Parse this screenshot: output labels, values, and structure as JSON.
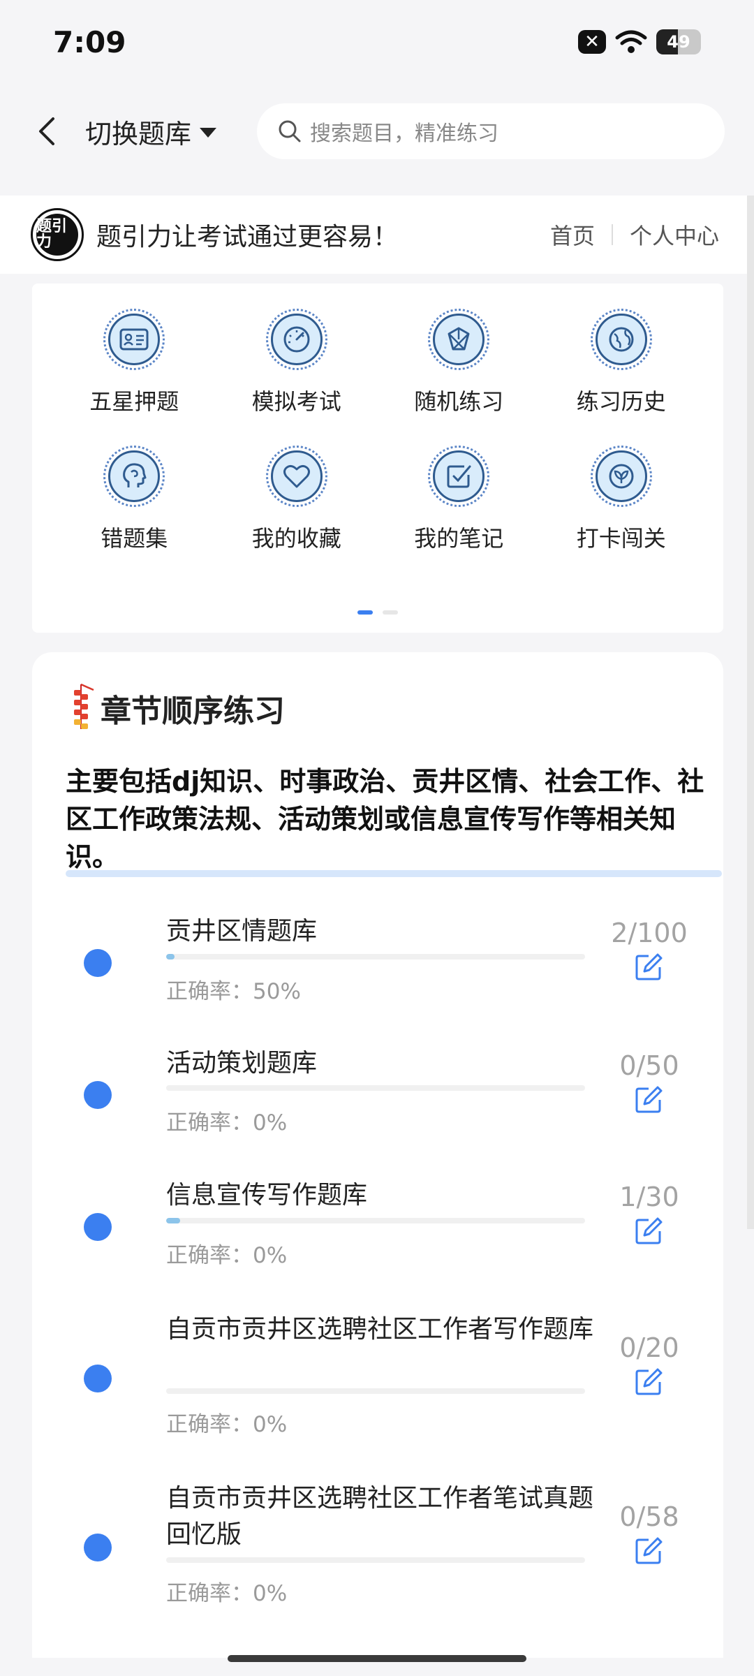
{
  "status_bar": {
    "time": "7:09",
    "battery": "49",
    "battery_level": 0.49
  },
  "header": {
    "switch_label": "切换题库",
    "search_placeholder": "搜索题目，精准练习"
  },
  "banner": {
    "slogan": "题引力让考试通过更容易！",
    "nav": [
      "首页",
      "个人中心"
    ],
    "logo_text": "题引力"
  },
  "grid": {
    "items": [
      {
        "label": "五星押题",
        "icon": "id-card-icon"
      },
      {
        "label": "模拟考试",
        "icon": "speedometer-icon"
      },
      {
        "label": "随机练习",
        "icon": "shuffle-icon"
      },
      {
        "label": "练习历史",
        "icon": "globe-icon"
      },
      {
        "label": "错题集",
        "icon": "head-icon"
      },
      {
        "label": "我的收藏",
        "icon": "heart-icon"
      },
      {
        "label": "我的笔记",
        "icon": "note-check-icon"
      },
      {
        "label": "打卡闯关",
        "icon": "leaf-badge-icon"
      }
    ],
    "page_count": 2,
    "active_page": 0
  },
  "chapter": {
    "title": "章节顺序练习",
    "description": "主要包括dj知识、时事政治、贡井区情、社会工作、社区工作政策法规、活动策划或信息宣传写作等相关知识。",
    "banks": [
      {
        "name": "贡井区情题库",
        "accuracy": "正确率：50%",
        "count": "2/100",
        "progress": 0.02
      },
      {
        "name": "活动策划题库",
        "accuracy": "正确率：0%",
        "count": "0/50",
        "progress": 0
      },
      {
        "name": "信息宣传写作题库",
        "accuracy": "正确率：0%",
        "count": "1/30",
        "progress": 0.033
      },
      {
        "name": "自贡市贡井区选聘社区工作者写作题库",
        "accuracy": "正确率：0%",
        "count": "0/20",
        "progress": 0
      },
      {
        "name": "自贡市贡井区选聘社区工作者笔试真题回忆版",
        "accuracy": "正确率：0%",
        "count": "0/58",
        "progress": 0
      }
    ]
  },
  "colors": {
    "accent": "#3b7ff0",
    "bar_fill": "#8cc4ea",
    "icon_bg": "#d9ecfb",
    "icon_stroke": "#2f5b8f"
  }
}
